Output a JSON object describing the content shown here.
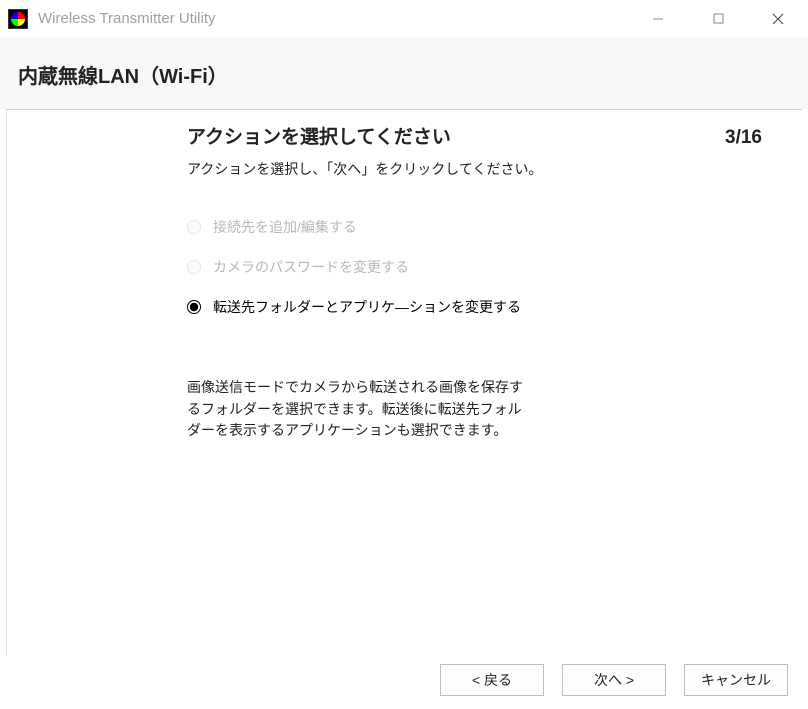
{
  "titlebar": {
    "app_title": "Wireless Transmitter Utility"
  },
  "header": {
    "title": "内蔵無線LAN（Wi-Fi）"
  },
  "step": {
    "title": "アクションを選択してください",
    "count": "3/16",
    "instruction": "アクションを選択し、「次へ」をクリックしてください。"
  },
  "options": [
    {
      "label": "接続先を追加/編集する",
      "enabled": false,
      "selected": false
    },
    {
      "label": "カメラのパスワードを変更する",
      "enabled": false,
      "selected": false
    },
    {
      "label": "転送先フォルダーとアプリケ―ションを変更する",
      "enabled": true,
      "selected": true
    }
  ],
  "description": "画像送信モードでカメラから転送される画像を保存するフォルダーを選択できます。転送後に転送先フォルダーを表示するアプリケーションも選択できます。",
  "buttons": {
    "back": "<  戻る",
    "next": "次へ  >",
    "cancel": "キャンセル"
  }
}
